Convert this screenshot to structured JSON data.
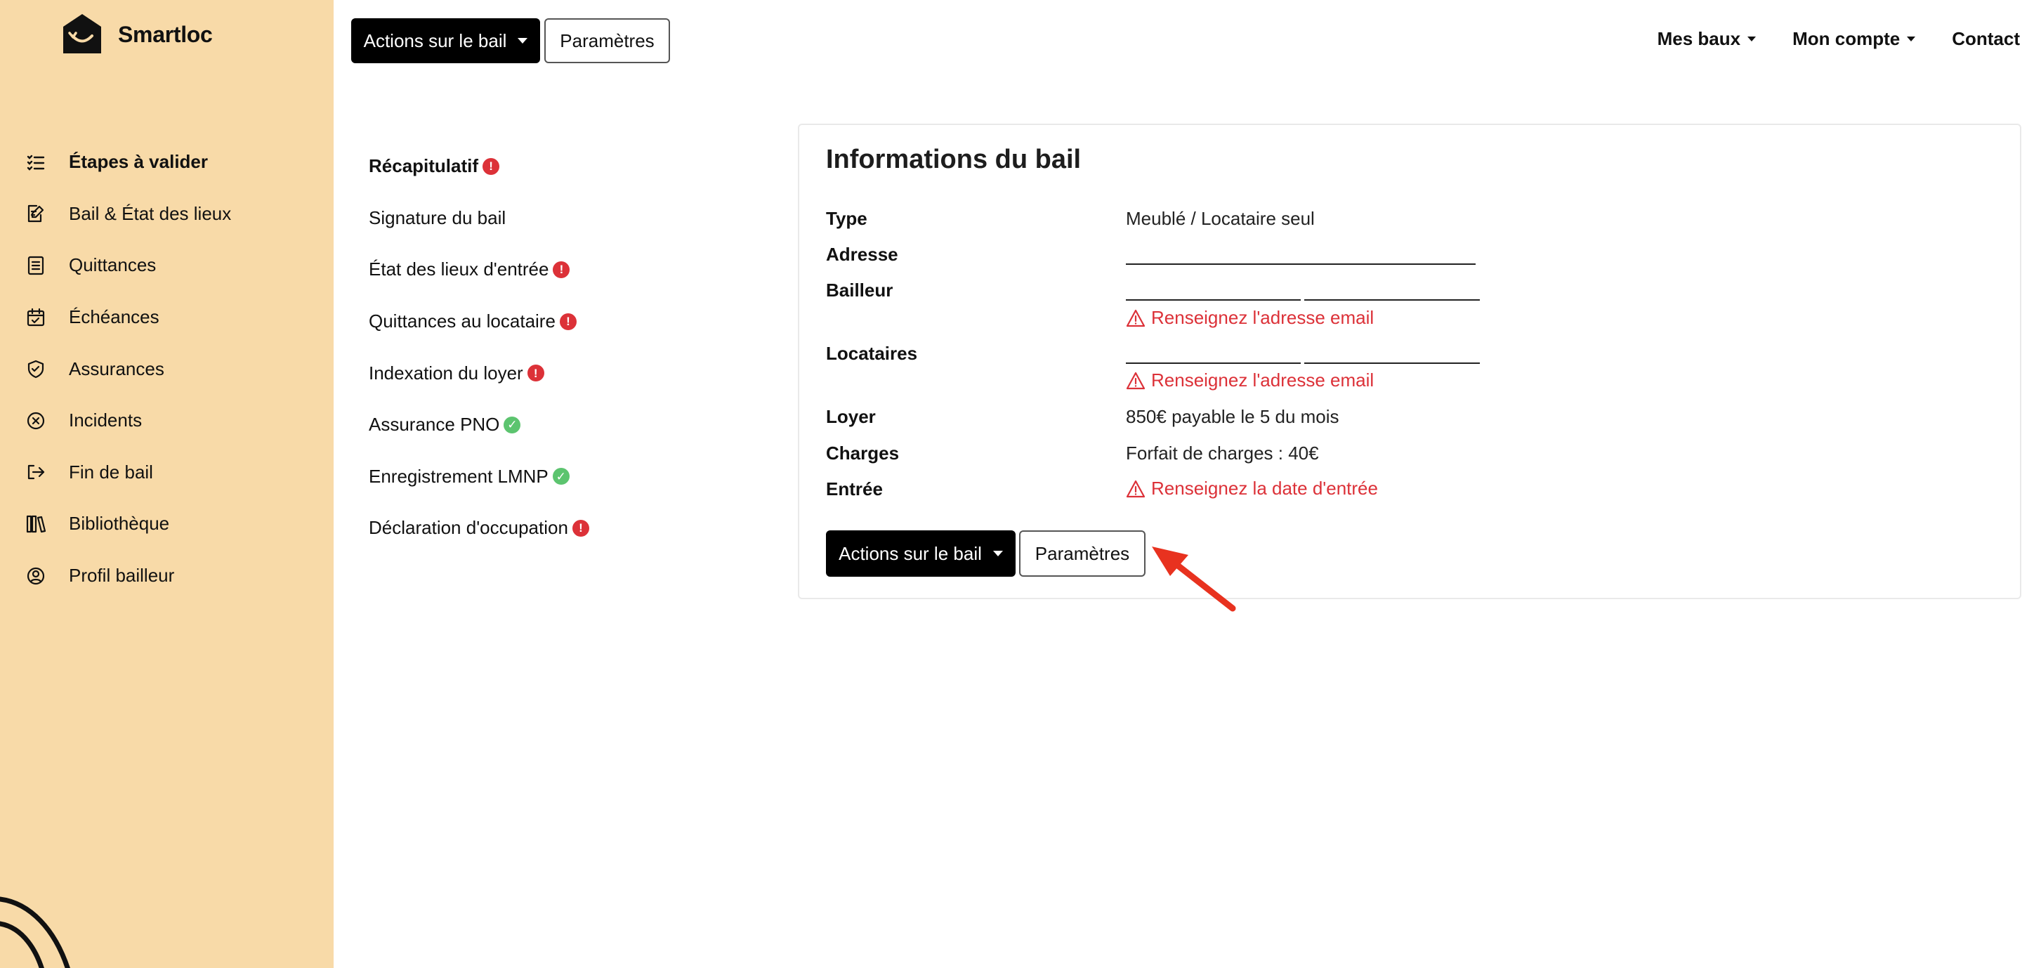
{
  "brand": {
    "name": "Smartloc",
    "logo_icon": "house-logo-icon"
  },
  "topbar": {
    "actions_label": "Actions sur le bail",
    "params_label": "Paramètres",
    "nav": [
      {
        "label": "Mes baux",
        "dropdown": true
      },
      {
        "label": "Mon compte",
        "dropdown": true
      },
      {
        "label": "Contact",
        "dropdown": false
      }
    ]
  },
  "sidebar": {
    "items": [
      {
        "label": "Étapes à valider",
        "icon": "checklist-icon",
        "active": true
      },
      {
        "label": "Bail & État des lieux",
        "icon": "edit-document-icon",
        "active": false
      },
      {
        "label": "Quittances",
        "icon": "receipt-icon",
        "active": false
      },
      {
        "label": "Échéances",
        "icon": "calendar-check-icon",
        "active": false
      },
      {
        "label": "Assurances",
        "icon": "shield-icon",
        "active": false
      },
      {
        "label": "Incidents",
        "icon": "circle-x-icon",
        "active": false
      },
      {
        "label": "Fin de bail",
        "icon": "exit-icon",
        "active": false
      },
      {
        "label": "Bibliothèque",
        "icon": "library-icon",
        "active": false
      },
      {
        "label": "Profil bailleur",
        "icon": "user-circle-icon",
        "active": false
      }
    ]
  },
  "steps": [
    {
      "label": "Récapitulatif",
      "status": "error",
      "active": true
    },
    {
      "label": "Signature du bail",
      "status": "none",
      "active": false
    },
    {
      "label": "État des lieux d'entrée",
      "status": "error",
      "active": false
    },
    {
      "label": "Quittances au locataire",
      "status": "error",
      "active": false
    },
    {
      "label": "Indexation du loyer",
      "status": "error",
      "active": false
    },
    {
      "label": "Assurance PNO",
      "status": "ok",
      "active": false
    },
    {
      "label": "Enregistrement LMNP",
      "status": "ok",
      "active": false
    },
    {
      "label": "Déclaration d'occupation",
      "status": "error",
      "active": false
    }
  ],
  "card": {
    "title": "Informations du bail",
    "labels": {
      "type": "Type",
      "adresse": "Adresse",
      "bailleur": "Bailleur",
      "locataires": "Locataires",
      "loyer": "Loyer",
      "charges": "Charges",
      "entree": "Entrée"
    },
    "values": {
      "type": "Meublé / Locataire seul",
      "loyer": "850€ payable le 5 du mois",
      "charges": "Forfait de charges : 40€"
    },
    "warnings": {
      "bailleur": "Renseignez l'adresse email",
      "locataires": "Renseignez l'adresse email",
      "entree": "Renseignez la date d'entrée"
    },
    "actions_label": "Actions sur le bail",
    "params_label": "Paramètres"
  },
  "colors": {
    "sidebar_bg": "#f8daa8",
    "error": "#dc3138",
    "success": "#5cc46f",
    "primary_button": "#000000",
    "annotation_arrow": "#e8321f"
  }
}
